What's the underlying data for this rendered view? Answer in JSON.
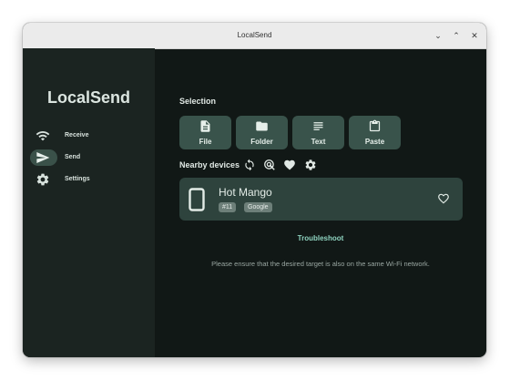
{
  "window": {
    "title": "LocalSend",
    "controls": [
      "⌄",
      "⌃",
      "✕"
    ]
  },
  "sidebar": {
    "app_name": "LocalSend",
    "items": [
      {
        "label": "Receive",
        "icon": "wifi-icon",
        "active": false
      },
      {
        "label": "Send",
        "icon": "send-icon",
        "active": true
      },
      {
        "label": "Settings",
        "icon": "gear-icon",
        "active": false
      }
    ]
  },
  "selection": {
    "title": "Selection",
    "buttons": [
      {
        "label": "File",
        "icon": "file-icon"
      },
      {
        "label": "Folder",
        "icon": "folder-icon"
      },
      {
        "label": "Text",
        "icon": "text-icon"
      },
      {
        "label": "Paste",
        "icon": "clipboard-icon"
      }
    ]
  },
  "nearby": {
    "title": "Nearby devices",
    "icons": [
      "refresh-icon",
      "scan-icon",
      "heart-icon",
      "gear-icon"
    ]
  },
  "device": {
    "name": "Hot Mango",
    "badges": [
      "#11",
      "Google"
    ],
    "icon": "phone-icon",
    "favorite_icon": "heart-outline-icon"
  },
  "troubleshoot_label": "Troubleshoot",
  "hint": "Please ensure that the desired target is also on the same Wi-Fi network.",
  "colors": {
    "background": "#111816",
    "sidebar": "#1b2421",
    "button": "#39534b",
    "device_card": "#2e433d",
    "accent": "#8fd4c0"
  }
}
